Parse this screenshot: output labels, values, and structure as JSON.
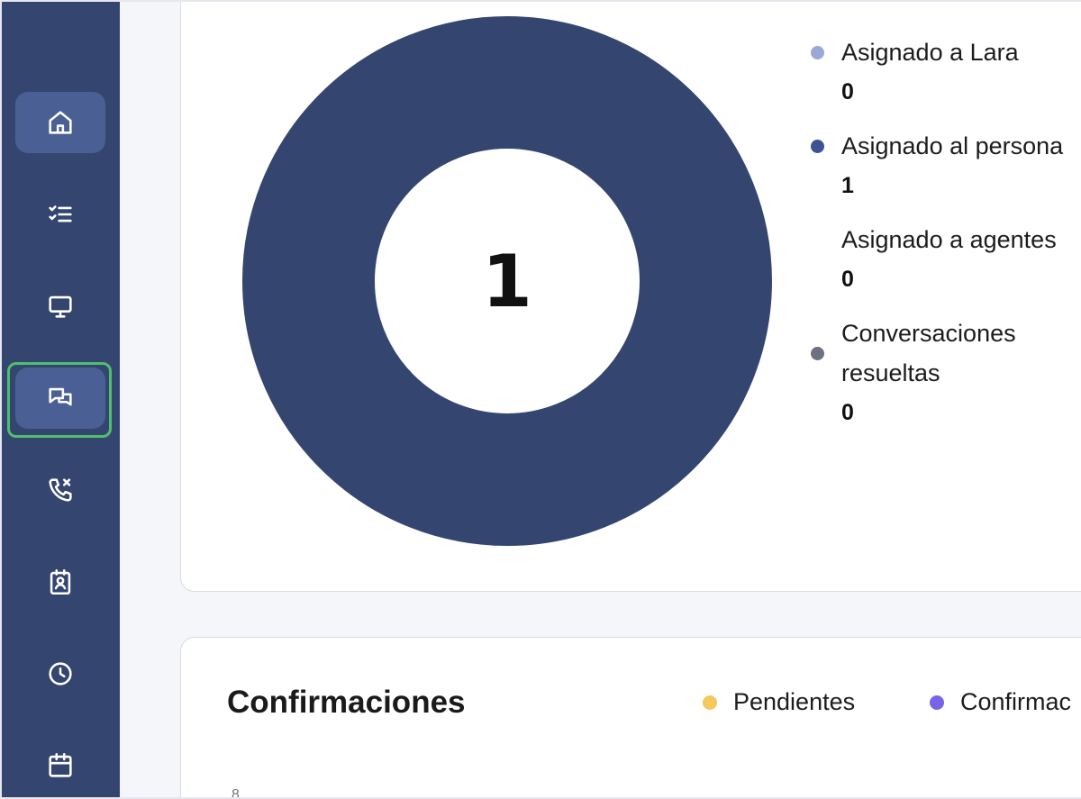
{
  "sidebar": {
    "items": [
      {
        "name": "home",
        "icon": "home-icon",
        "state": "active"
      },
      {
        "name": "tasks",
        "icon": "checklist-icon",
        "state": "normal"
      },
      {
        "name": "monitor",
        "icon": "monitor-icon",
        "state": "normal"
      },
      {
        "name": "conversations",
        "icon": "chat-bubbles-icon",
        "state": "highlighted"
      },
      {
        "name": "missed-calls",
        "icon": "phone-missed-icon",
        "state": "normal"
      },
      {
        "name": "contacts",
        "icon": "contact-badge-icon",
        "state": "normal"
      },
      {
        "name": "history",
        "icon": "clock-icon",
        "state": "normal"
      },
      {
        "name": "calendar",
        "icon": "calendar-icon",
        "state": "normal"
      }
    ]
  },
  "colors": {
    "sidebar_bg": "#34466f",
    "active_item": "#4a5f94",
    "focus_ring": "#4fbf6e",
    "donut": "#34466f"
  },
  "conversations": {
    "total": "1",
    "chart_data": {
      "type": "pie",
      "categories": [
        "Asignado a Lara",
        "Asignado al personal",
        "Asignado a agentes",
        "Conversaciones resueltas"
      ],
      "values": [
        0,
        1,
        0,
        0
      ],
      "colors": [
        "#9aa8d6",
        "#3e5394",
        "#ffffff",
        "#6e7280"
      ]
    },
    "legend": [
      {
        "label": "Asignado a Lara",
        "value": "0",
        "color": "#9aa8d6"
      },
      {
        "label": "Asignado al persona",
        "value": "1",
        "color": "#3e5394"
      },
      {
        "label": "Asignado a agentes",
        "value": "0",
        "color": "#ffffff"
      },
      {
        "label": "Conversaciones resueltas",
        "value": "0",
        "color": "#6e7280"
      }
    ]
  },
  "confirmaciones": {
    "title": "Confirmaciones",
    "legend": [
      {
        "label": "Pendientes",
        "color": "#f5c85b"
      },
      {
        "label": "Confirmac",
        "color": "#7b63e8"
      }
    ],
    "axis_first_tick": "8"
  }
}
